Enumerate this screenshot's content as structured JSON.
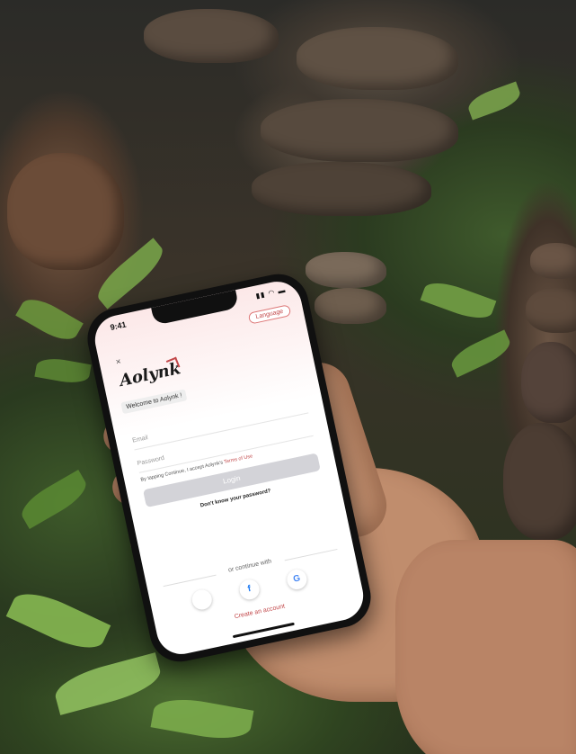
{
  "phone": {
    "status_time": "9:41",
    "language_button": "Language",
    "close_glyph": "×",
    "logo_text": "Aolynk",
    "welcome_text": "Welcome to Aolynk !",
    "email_placeholder": "Email",
    "password_placeholder": "Password",
    "terms_prefix": "By tapping Continue, I accept Aolynk's",
    "terms_link": "Terms of Use",
    "login_button": "Login",
    "forgot_password": "Don't know your password?",
    "continue_with": "or continue with",
    "create_account": "Create an account",
    "social_icons": [
      "apple-icon",
      "facebook-icon",
      "google-icon"
    ],
    "accent_color": "#c2484a"
  }
}
